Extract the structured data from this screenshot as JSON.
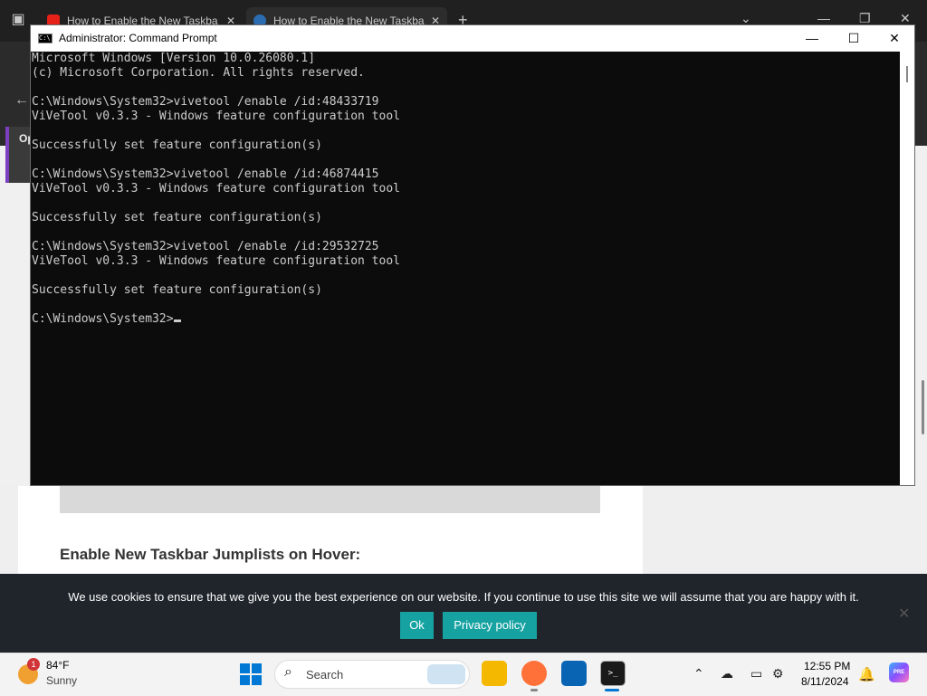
{
  "browser": {
    "tabs": [
      {
        "title": "How to Enable the New Taskba"
      },
      {
        "title": "How to Enable the New Taskba"
      }
    ],
    "new_tab": "+",
    "side_label": "Op"
  },
  "cmd": {
    "title": "Administrator: Command Prompt",
    "icon_text": "C:\\",
    "controls": {
      "minimize": "—",
      "maximize": "☐",
      "close": "✕"
    },
    "lines": [
      "Microsoft Windows [Version 10.0.26080.1]",
      "(c) Microsoft Corporation. All rights reserved.",
      "",
      "C:\\Windows\\System32>vivetool /enable /id:48433719",
      "ViVeTool v0.3.3 - Windows feature configuration tool",
      "",
      "Successfully set feature configuration(s)",
      "",
      "C:\\Windows\\System32>vivetool /enable /id:46874415",
      "ViVeTool v0.3.3 - Windows feature configuration tool",
      "",
      "Successfully set feature configuration(s)",
      "",
      "C:\\Windows\\System32>vivetool /enable /id:29532725",
      "ViVeTool v0.3.3 - Windows feature configuration tool",
      "",
      "Successfully set feature configuration(s)",
      ""
    ],
    "prompt": "C:\\Windows\\System32>"
  },
  "article": {
    "heading": "Enable New Taskbar Jumplists on Hover:"
  },
  "cookie": {
    "text": "We use cookies to ensure that we give you the best experience on our website. If you continue to use this site we will assume that you are happy with it.",
    "ok_label": "Ok",
    "privacy_label": "Privacy policy",
    "accent_color": "#17a2a2"
  },
  "taskbar": {
    "weather": {
      "temp": "84°F",
      "condition": "Sunny",
      "badge": "1"
    },
    "search_label": "Search",
    "terminal_icon_text": ">_",
    "clock": {
      "time": "12:55 PM",
      "date": "8/11/2024"
    },
    "copilot_badge": "PRE"
  }
}
